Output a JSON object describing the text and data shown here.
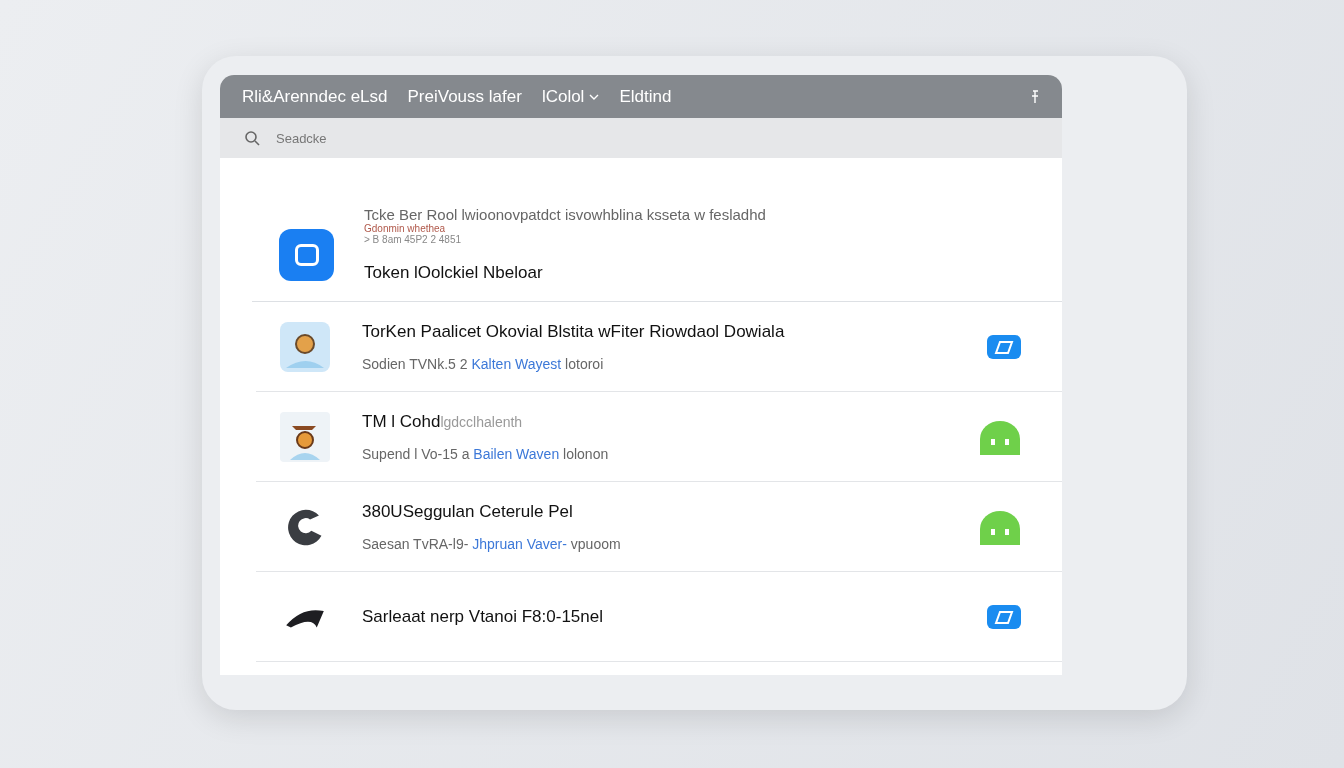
{
  "menu_bar": {
    "items": [
      {
        "label": "Rli&Arenndec eLsd",
        "kind": "plain"
      },
      {
        "label": "PreiVouss lafer",
        "kind": "plain"
      },
      {
        "label": "lColol",
        "kind": "dropdown"
      },
      {
        "label": "Eldtind",
        "kind": "plain"
      }
    ]
  },
  "search": {
    "placeholder": "Seadcke"
  },
  "featured": {
    "caption": "Tcke Ber Rool lwioonovpatdct isvowhblina ksseta w fesladhd",
    "note": "Gdonmin whethea",
    "meta": "> B 8am 45P2 2 4851",
    "title": "Token lOolckiel Nbeloar"
  },
  "apps": [
    {
      "title": "TorKen Paalicet Okovial Blstita wFiter Riowdaol Dowiala",
      "subtitle": "Sodien TVNk.5 2",
      "link": "Kalten Wayest",
      "subtitle_end": "lotoroi",
      "kind": "store"
    },
    {
      "title": "TM l Cohd",
      "title_extra": "lgdcclhalenth",
      "subtitle": "Supend l Vo-15 a",
      "link": "Bailen Waven",
      "subtitle_end": "lolonon",
      "kind": "android"
    },
    {
      "title": "380USeggulan Ceterule Pel",
      "subtitle": "Saesan TvRA-l9-",
      "link": "Jhpruan Vaver-",
      "subtitle_end": "vpuoom",
      "kind": "android"
    },
    {
      "title": "Sarleaat nerp Vtanoi F8:0-15nel",
      "kind": "store"
    }
  ]
}
